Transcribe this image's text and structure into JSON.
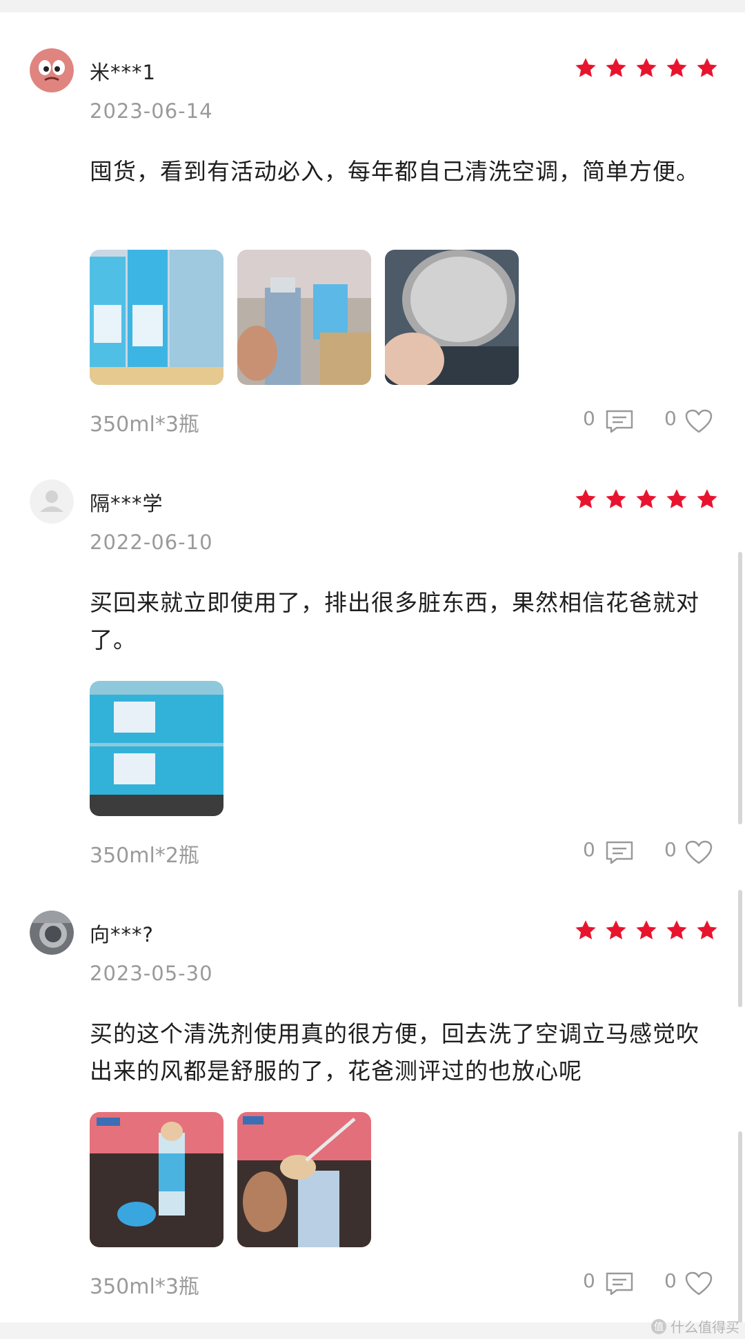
{
  "reviews": [
    {
      "username": "米***1",
      "date": "2023-06-14",
      "rating": 5,
      "content": "囤货，看到有活动必入，每年都自己清洗空调，简单方便。",
      "photo_count": 3,
      "spec": "350ml*3瓶",
      "comment_count": "0",
      "like_count": "0"
    },
    {
      "username": "隔***学",
      "date": "2022-06-10",
      "rating": 5,
      "content": "买回来就立即使用了，排出很多脏东西，果然相信花爸就对了。",
      "photo_count": 1,
      "spec": "350ml*2瓶",
      "comment_count": "0",
      "like_count": "0"
    },
    {
      "username": "向***?",
      "date": "2023-05-30",
      "rating": 5,
      "content": "买的这个清洗剂使用真的很方便，回去洗了空调立马感觉吹出来的风都是舒服的了，花爸测评过的也放心呢",
      "photo_count": 2,
      "spec": "350ml*3瓶",
      "comment_count": "0",
      "like_count": "0"
    }
  ],
  "watermark": {
    "text": "什么值得买",
    "logo": "值"
  },
  "colors": {
    "star": "#e8142e",
    "muted_text": "#9a9a9a",
    "icon": "#999999"
  },
  "icons": {
    "rating": "star-icon",
    "comment": "comment-icon",
    "like": "heart-icon"
  }
}
